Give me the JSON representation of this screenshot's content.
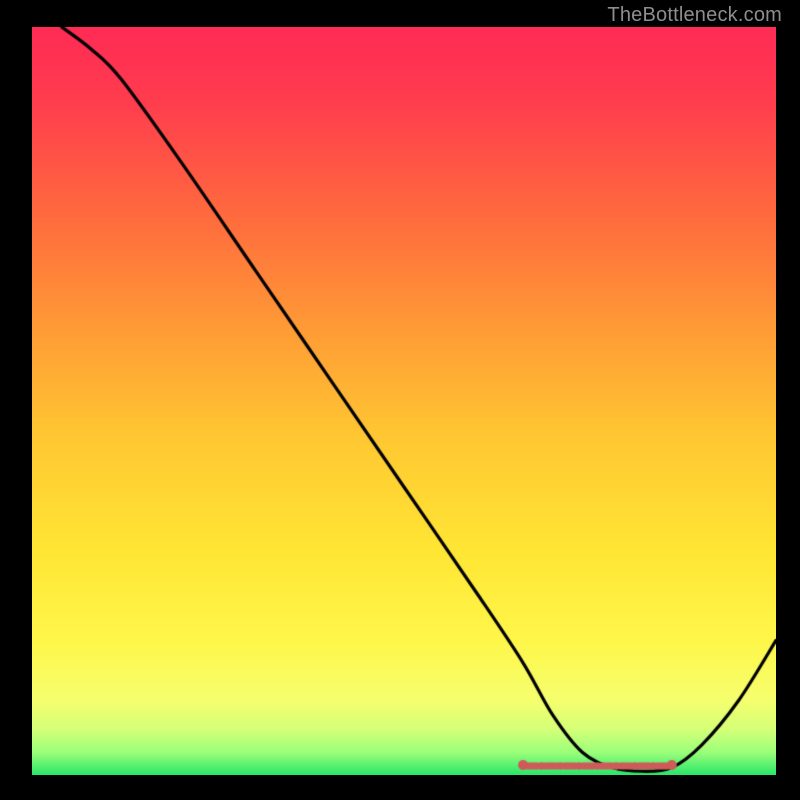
{
  "watermark": "TheBottleneck.com",
  "chart_data": {
    "type": "line",
    "title": "",
    "xlabel": "",
    "ylabel": "",
    "xlim": [
      0,
      100
    ],
    "ylim": [
      0,
      100
    ],
    "series": [
      {
        "name": "curve",
        "x": [
          4,
          8,
          12,
          20,
          30,
          40,
          50,
          60,
          66,
          70,
          74,
          78,
          82,
          86,
          90,
          95,
          100
        ],
        "y": [
          100,
          97,
          93,
          82,
          67.5,
          53,
          38.5,
          24,
          15,
          8,
          3,
          1,
          0.5,
          1,
          4,
          10,
          18
        ]
      }
    ],
    "floor_band": {
      "from_x": 66,
      "to_x": 86,
      "y": 1.2
    },
    "gradient_stops": [
      {
        "t": 0.0,
        "color": "#ff2b55"
      },
      {
        "t": 0.1,
        "color": "#ff3d4e"
      },
      {
        "t": 0.25,
        "color": "#ff6a3e"
      },
      {
        "t": 0.4,
        "color": "#ff9a36"
      },
      {
        "t": 0.55,
        "color": "#ffc832"
      },
      {
        "t": 0.7,
        "color": "#ffe634"
      },
      {
        "t": 0.82,
        "color": "#fff74a"
      },
      {
        "t": 0.9,
        "color": "#f6ff6e"
      },
      {
        "t": 0.94,
        "color": "#d4ff78"
      },
      {
        "t": 0.97,
        "color": "#9bff7a"
      },
      {
        "t": 1.0,
        "color": "#28e66a"
      }
    ],
    "colors": {
      "curve": "#000000",
      "floor_dots": "#cf5a5a",
      "background_frame": "#000000"
    }
  }
}
